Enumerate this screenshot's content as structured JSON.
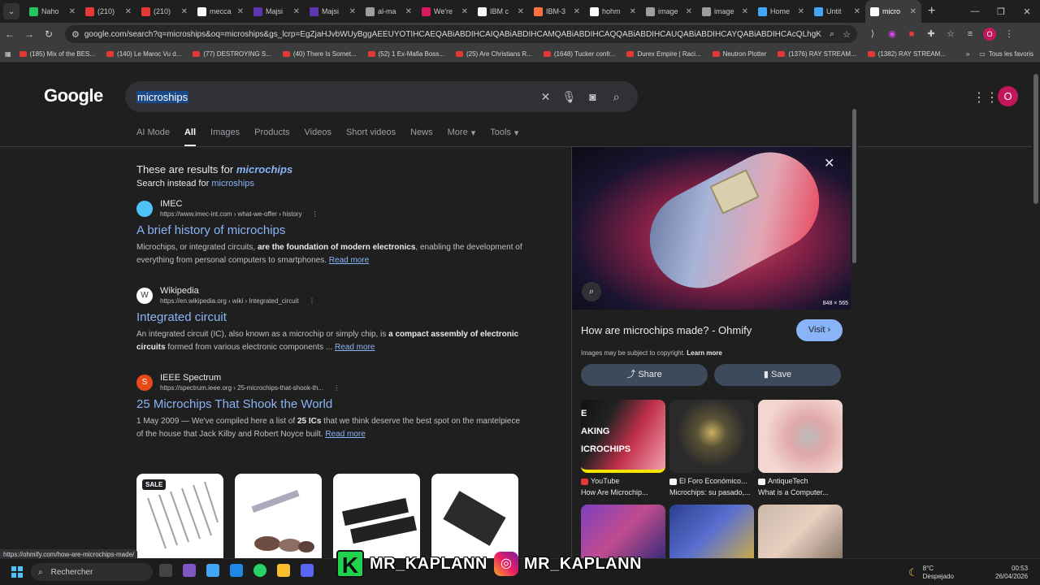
{
  "browser": {
    "tabs": [
      {
        "label": "Naho",
        "color": "#22c55e"
      },
      {
        "label": "(210)",
        "color": "#e53935"
      },
      {
        "label": "(210)",
        "color": "#e53935"
      },
      {
        "label": "mecca",
        "color": "#fafafa"
      },
      {
        "label": "Majsi",
        "color": "#5e35b1"
      },
      {
        "label": "Majsi",
        "color": "#5e35b1"
      },
      {
        "label": "al-ma",
        "color": "#9e9e9e"
      },
      {
        "label": "We're",
        "color": "#d81b60"
      },
      {
        "label": "IBM c",
        "color": "#fafafa"
      },
      {
        "label": "IBM-3",
        "color": "#ff7043"
      },
      {
        "label": "hohm",
        "color": "#fafafa"
      },
      {
        "label": "image",
        "color": "#9e9e9e"
      },
      {
        "label": "image",
        "color": "#9e9e9e"
      },
      {
        "label": "Home",
        "color": "#42a5f5"
      },
      {
        "label": "Untit",
        "color": "#42a5f5"
      },
      {
        "label": "micro",
        "color": "#fafafa",
        "active": true
      }
    ],
    "url": "google.com/search?q=microships&oq=microships&gs_lcrp=EgZjaHJvbWUyBggAEEUYOTIHCAEQABiABDIHCAIQABiABDIHCAMQABiABDIHCAQQABiABDIHCAUQABiABDIHCAYQABiABDIHCAcQLhgKGAsYxwEY0QMYgA...",
    "profile_initial": "O",
    "bookmarks": [
      "(185) Mix of the BES...",
      "(140) Le Maroc Vu d...",
      "(77) DESTROYING S...",
      "(40) There Is Somet...",
      "(52) 1 Ex-Mafia Boss...",
      "(25) Are Christians R...",
      "(1648) Tucker confr...",
      "Durex Empire | Raci...",
      "Neutron Plotter",
      "(1376) RAY STREAM...",
      "(1382) RAY STREAM..."
    ],
    "all_bookmarks": "Tous les favoris"
  },
  "google": {
    "logo": "Google",
    "query": "microships",
    "profile_initial": "O",
    "tabs": [
      "AI Mode",
      "All",
      "Images",
      "Products",
      "Videos",
      "Short videos",
      "News",
      "More",
      "Tools"
    ],
    "correction": {
      "line1_prefix": "These are results for ",
      "line1_term": "microchips",
      "line2_prefix": "Search instead for ",
      "line2_term": "microships"
    },
    "results": [
      {
        "site": "IMEC",
        "url": "https://www.imec-int.com › what-we-offer › history",
        "title": "A brief history of microchips",
        "snippet_a": "Microchips, or integrated circuits, ",
        "snippet_b": "are the foundation of modern electronics",
        "snippet_c": ", enabling the development of everything from personal computers to smartphones.",
        "read_more": "Read more"
      },
      {
        "site": "Wikipedia",
        "url": "https://en.wikipedia.org › wiki › Integrated_circuit",
        "title": "Integrated circuit",
        "snippet_a": "An integrated circuit (IC), also known as a microchip or simply chip, is ",
        "snippet_b": "a compact assembly of electronic circuits",
        "snippet_c": " formed from various electronic components ...",
        "read_more": "Read more"
      },
      {
        "site": "IEEE Spectrum",
        "url": "https://spectrum.ieee.org › 25-microchips-that-shook-th...",
        "title": "25 Microchips That Shook the World",
        "snippet_a": "1 May 2009 — We've compiled here a list of ",
        "snippet_b": "25 ICs",
        "snippet_c": " that we think deserve the best spot on the mantelpiece of the house that Jack Kilby and Robert Noyce built.",
        "read_more": "Read more"
      }
    ],
    "sale_badge": "SALE"
  },
  "panel": {
    "dims": "848 × 565",
    "title": "How are microchips made? - Ohmify",
    "visit": "Visit",
    "copyright": "Images may be subject to copyright.",
    "learn_more": "Learn more",
    "share": "Share",
    "save": "Save",
    "related": [
      {
        "source": "YouTube",
        "caption": "How Are Microchip...",
        "src_color": "#e53935"
      },
      {
        "source": "El Foro Económico...",
        "caption": "Microchips: su pasado,...",
        "src_color": "#fafafa"
      },
      {
        "source": "AntiqueTech",
        "caption": "What is a Computer...",
        "src_color": "#fafafa"
      }
    ],
    "thumb_text": "E\nAKING\nICROCHIPS"
  },
  "status_url": "https://ohmify.com/how-are-microchips-made/",
  "taskbar": {
    "search": "Rechercher",
    "overlay_handle": "MR_KAPLANN",
    "weather_temp": "8°C",
    "weather_desc": "Despejado",
    "time": "00:53",
    "date": "26/04/2026"
  }
}
